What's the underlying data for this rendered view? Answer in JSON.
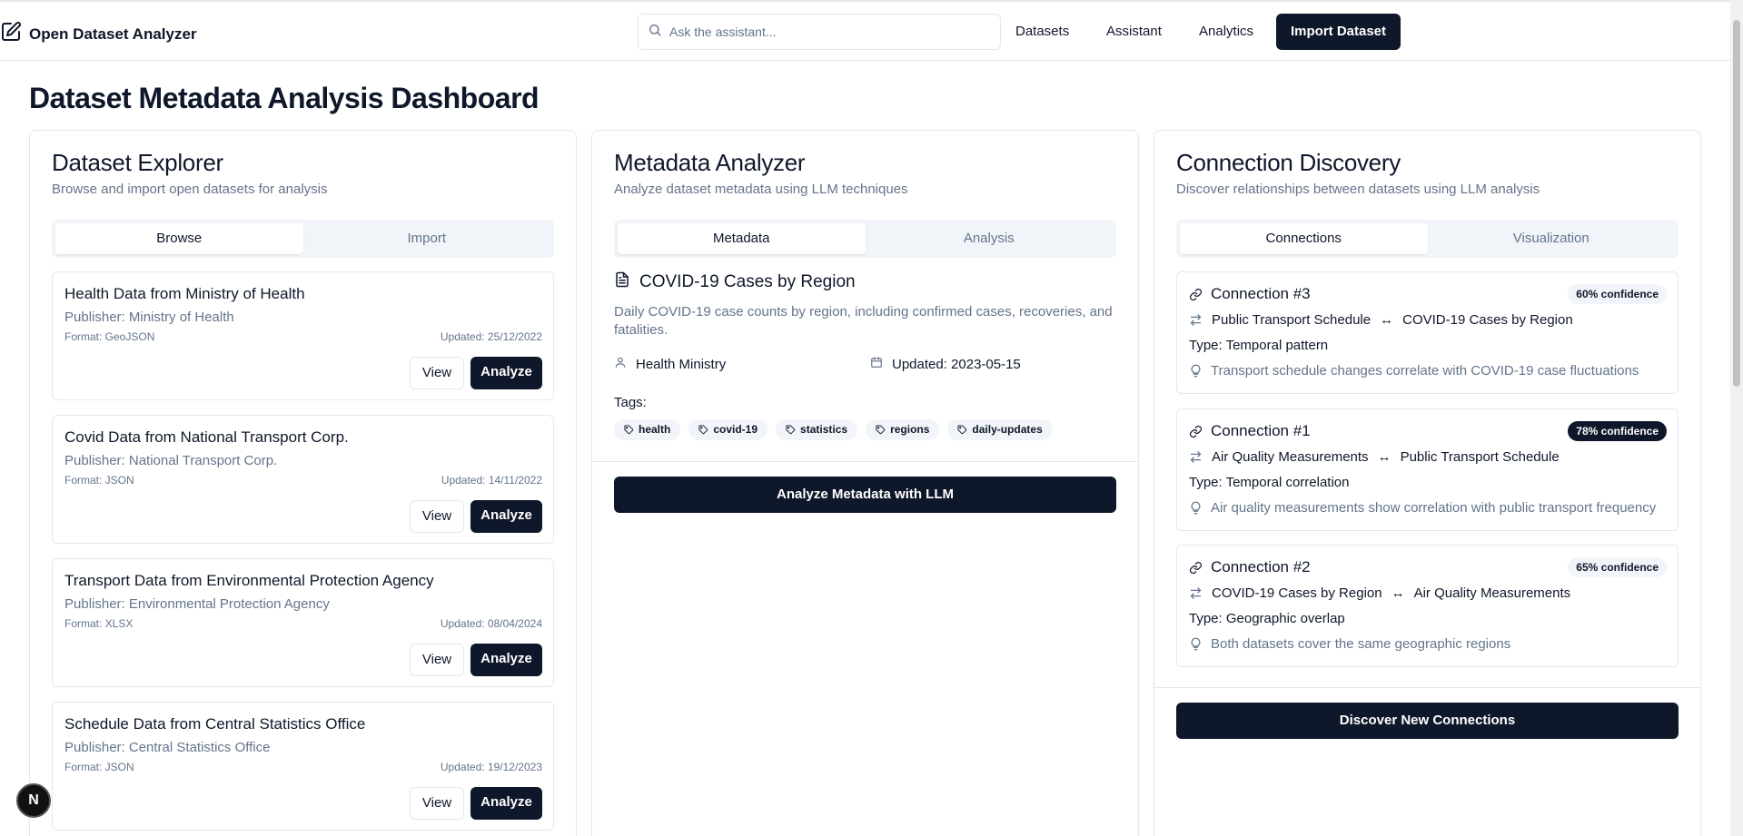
{
  "app": {
    "name": "Open Dataset Analyzer"
  },
  "search": {
    "placeholder": "Ask the assistant..."
  },
  "nav": {
    "datasets": "Datasets",
    "assistant": "Assistant",
    "analytics": "Analytics",
    "import": "Import Dataset"
  },
  "page": {
    "title": "Dataset Metadata Analysis Dashboard"
  },
  "explorer": {
    "title": "Dataset Explorer",
    "description": "Browse and import open datasets for analysis",
    "tabs": [
      "Browse",
      "Import"
    ],
    "view_label": "View",
    "analyze_label": "Analyze",
    "items": [
      {
        "title": "Health Data from Ministry of Health",
        "publisher": "Publisher: Ministry of Health",
        "format": "Format: GeoJSON",
        "updated": "Updated: 25/12/2022"
      },
      {
        "title": "Covid Data from National Transport Corp.",
        "publisher": "Publisher: National Transport Corp.",
        "format": "Format: JSON",
        "updated": "Updated: 14/11/2022"
      },
      {
        "title": "Transport Data from Environmental Protection Agency",
        "publisher": "Publisher: Environmental Protection Agency",
        "format": "Format: XLSX",
        "updated": "Updated: 08/04/2024"
      },
      {
        "title": "Schedule Data from Central Statistics Office",
        "publisher": "Publisher: Central Statistics Office",
        "format": "Format: JSON",
        "updated": "Updated: 19/12/2023"
      }
    ]
  },
  "analyzer": {
    "title": "Metadata Analyzer",
    "description": "Analyze dataset metadata using LLM techniques",
    "tabs": [
      "Metadata",
      "Analysis"
    ],
    "dataset_title": "COVID-19 Cases by Region",
    "dataset_description": "Daily COVID-19 case counts by region, including confirmed cases, recoveries, and fatalities.",
    "publisher": "Health Ministry",
    "updated": "Updated: 2023-05-15",
    "tags_label": "Tags:",
    "tags": [
      "health",
      "covid-19",
      "statistics",
      "regions",
      "daily-updates"
    ],
    "action": "Analyze Metadata with LLM"
  },
  "discovery": {
    "title": "Connection Discovery",
    "description": "Discover relationships between datasets using LLM analysis",
    "tabs": [
      "Connections",
      "Visualization"
    ],
    "type_prefix": "Type:",
    "connections": [
      {
        "title": "Connection #3",
        "confidence": "60% confidence",
        "source": "Public Transport Schedule",
        "target": "COVID-19 Cases by Region",
        "type": "Temporal pattern",
        "insight": "Transport schedule changes correlate with COVID-19 case fluctuations"
      },
      {
        "title": "Connection #1",
        "confidence": "78% confidence",
        "source": "Air Quality Measurements",
        "target": "Public Transport Schedule",
        "type": "Temporal correlation",
        "insight": "Air quality measurements show correlation with public transport frequency"
      },
      {
        "title": "Connection #2",
        "confidence": "65% confidence",
        "source": "COVID-19 Cases by Region",
        "target": "Air Quality Measurements",
        "type": "Geographic overlap",
        "insight": "Both datasets cover the same geographic regions"
      }
    ],
    "action": "Discover New Connections"
  },
  "fab": {
    "label": "N"
  },
  "colors": {
    "primary": "#0f172a",
    "muted": "#64748b",
    "border": "#e2e8f0",
    "surface": "#f1f5f9"
  }
}
